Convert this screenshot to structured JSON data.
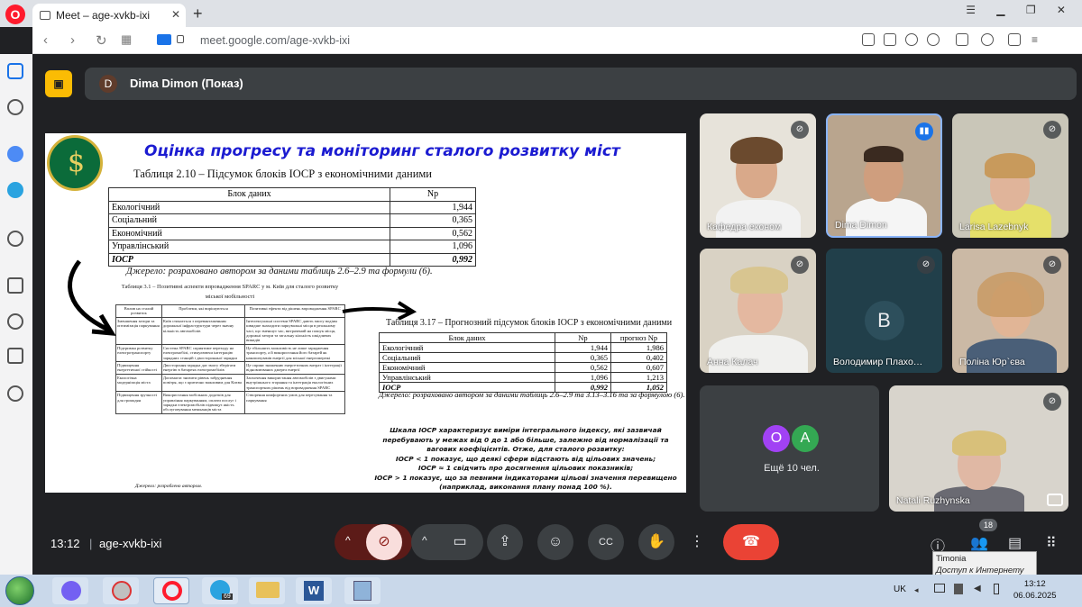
{
  "browser": {
    "tab_title": "Meet – age-xvkb-ixi",
    "url": "meet.google.com/age-xvkb-ixi"
  },
  "meet": {
    "presenter_initial": "D",
    "presenter_label": "Dima Dimon (Показ)",
    "time": "13:12",
    "meeting_code": "age-xvkb-ixi",
    "participant_count": "18",
    "more_people": "Ещё 10 чел.",
    "more_avatars": [
      "O",
      "A"
    ],
    "participants": [
      {
        "name": "Кафедра економ"
      },
      {
        "name": "Dima Dimon"
      },
      {
        "name": "Larisa Lazebnyk"
      },
      {
        "name": "Анна Калач"
      },
      {
        "name": "Володимир Плахо…",
        "initial": "В"
      },
      {
        "name": "Поліна Юр`єва"
      },
      {
        "name": "Natali Ruzhynska"
      }
    ],
    "tooltip": {
      "title": "Timonia",
      "subtitle": "Доступ к Интернету"
    }
  },
  "slide": {
    "title": "Оцінка прогресу та моніторинг сталого розвитку міст",
    "table1_caption": "Таблиця 2.10 – Підсумок блоків IОСР з економічними даними",
    "table1_headers": [
      "Блок даних",
      "Nр"
    ],
    "table1_rows": [
      {
        "block": "Екологічний",
        "value": "1,944"
      },
      {
        "block": "Соціальний",
        "value": "0,365"
      },
      {
        "block": "Економічний",
        "value": "0,562"
      },
      {
        "block": "Управлінський",
        "value": "1,096"
      },
      {
        "block": "IОСР",
        "value": "0,992"
      }
    ],
    "table1_source": "Джерело: розраховано автором за даними таблиць 2.6–2.9 та формули (6).",
    "table31_caption": "Таблиця 3.1 – Позитивні аспекти впровадження SPARC у м. Київ для сталого розвитку міської мобільності",
    "table31_headers": [
      "Вплив на сталий розвиток",
      "Проблеми, які вирішуються",
      "Позитивні ефекти від рішень впровадження SPARC"
    ],
    "table31_rows": [
      [
        "Зменшення затори та оптимізація паркування",
        "Київ стикається з перевантаженням дорожньої інфраструктури через значну кількість автомобілів",
        "Інтелектуальні системи SPARC дають змогу водіям швидше знаходити паркувальні місця в реальному часі, що зменшує час, витрачений на пошук місця, дорожні затори та загальну кількість шкідливих викидів"
      ],
      [
        "Підтримка розвитку електротранспорту",
        "Система SPARC сприятиме переходу на електромобілі, стимулюючи інтеграцію зарядних станцій і двосторонньої зарядки",
        "Це збільшить можливість не лише зарядження транспорту, а й використання його батарей як накопичувачів енергії для міської енергомережі"
      ],
      [
        "Підвищення енергетичної стійкості",
        "Двостороння зарядка дає змогу зберігати енергію в батареях електромобілів",
        "Це сприяє зниженню енергетичних витрат і інтеграції відновлюваних джерел енергії"
      ],
      [
        "Екологічна модернізація міста",
        "Допомагає знизити рівень забруднення повітря, що є критично важливим для Києва",
        "Заохочення використання автомобілів з двигунами внутрішнього згоряння та інтеграція екологічних транспортних рішень від впровадження SPARC"
      ],
      [
        "Підвищення зручності для громадян",
        "Використання мобільних додатків для управління паркуванням, оплати послуг і зарядки електромобілів підвищує якість обслуговування мешканців міста",
        "Створення комфортних умов для пересування та паркування"
      ]
    ],
    "table31_source": "Джерело: розроблено автором.",
    "table317_caption": "Таблиця 3.17 – Прогнозний підсумок блоків IОСР з економічними даними",
    "table317_headers": [
      "Блок даних",
      "Nр",
      "прогноз Nр"
    ],
    "table317_rows": [
      {
        "block": "Екологічний",
        "value": "1,944",
        "forecast": "1,986"
      },
      {
        "block": "Соціальний",
        "value": "0,365",
        "forecast": "0,402"
      },
      {
        "block": "Економічний",
        "value": "0,562",
        "forecast": "0,607"
      },
      {
        "block": "Управлінський",
        "value": "1,096",
        "forecast": "1,213"
      },
      {
        "block": "IОСР",
        "value": "0,992",
        "forecast": "1,052"
      }
    ],
    "table317_source": "Джерело: розраховано автором за даними таблиць 2.6–2.9 та 3.13–3.16 та за формулою (6).",
    "scale_text": [
      "Шкала IОСР характеризує виміри інтегрального індексу, які зазвичай перебувають у межах від 0 до 1 або більше, залежно від нормалізації та вагових коефіцієнтів. Отже, для сталого розвитку:",
      "IОСР < 1 показує, що деякі сфери відстають від цільових значень;",
      "IОСР ≈ 1 свідчить про досягнення цільових показників;",
      "IОСР > 1 показує, що за певними індикаторами цільові значення перевищено (наприклад, виконання плану понад 100 %)."
    ]
  },
  "taskbar": {
    "lang": "UK",
    "time": "13:12",
    "date": "06.06.2025",
    "telegram_badge": "69"
  }
}
